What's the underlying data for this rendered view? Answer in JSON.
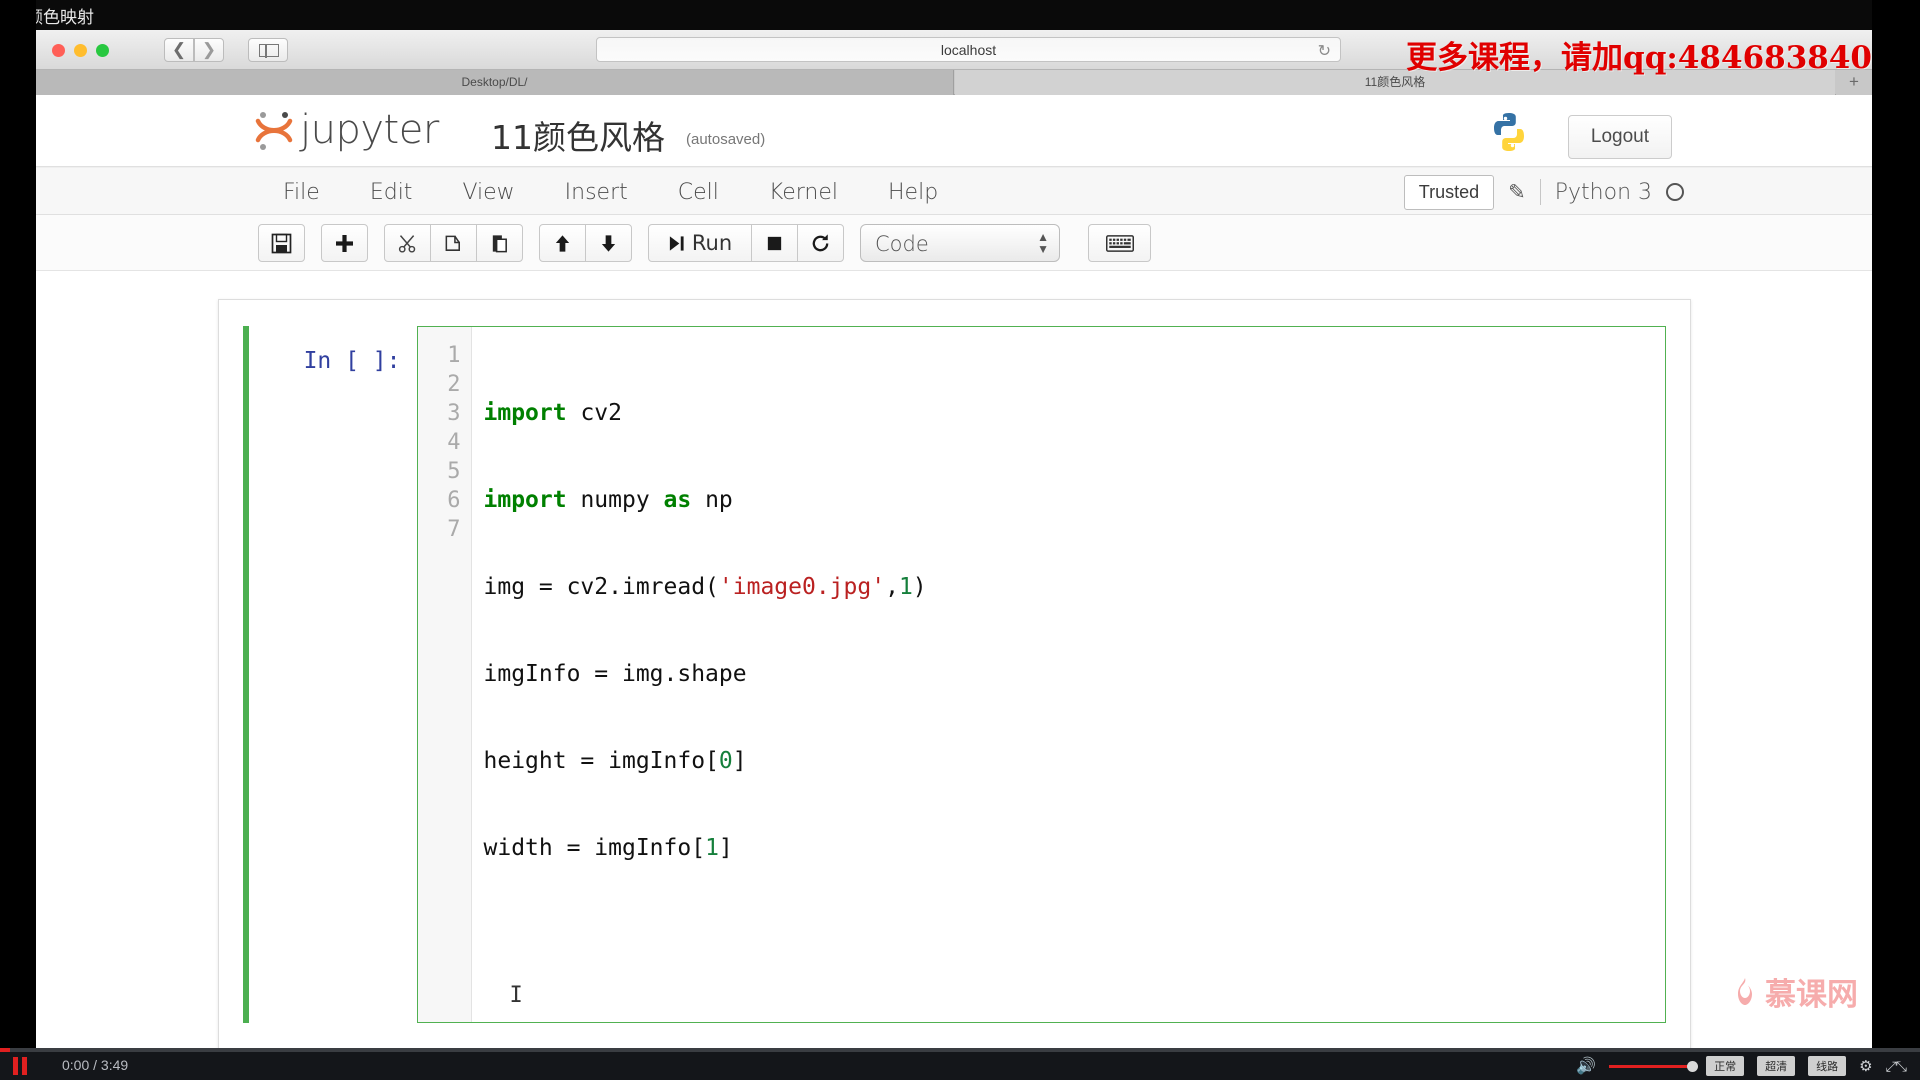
{
  "video": {
    "lesson_title": "颜色映射",
    "current_time": "0:00",
    "total_time": "3:49",
    "pause_icon": "pause-icon",
    "volume_icon": "volume-icon",
    "gear_icon": "gear-icon",
    "fullscreen_icon": "fullscreen-icon",
    "quality_buttons": [
      "正常",
      "超清",
      "线路"
    ],
    "watermark_text": "慕课网",
    "watermark_icon": "flame-icon"
  },
  "promo": {
    "text": "更多课程，请加qq:484683840",
    "color": "#e00000"
  },
  "browser": {
    "traffic_lights": [
      "close-red",
      "minimize-yellow",
      "maximize-green"
    ],
    "back_icon": "chevron-left-icon",
    "forward_icon": "chevron-right-icon",
    "sidebar_icon": "sidebar-toggle-icon",
    "url": "localhost",
    "reload_icon": "reload-icon",
    "new_tab_label": "+",
    "tabs": [
      {
        "label": "Desktop/DL/",
        "active": false
      },
      {
        "label": "11颜色风格",
        "active": true
      }
    ]
  },
  "jupyter": {
    "brand": "jupyter",
    "logo_icon": "jupyter-logo-icon",
    "notebook_title": "11颜色风格",
    "autosave_status": "(autosaved)",
    "python_badge_icon": "python-logo-icon",
    "logout_label": "Logout",
    "menu": [
      "File",
      "Edit",
      "View",
      "Insert",
      "Cell",
      "Kernel",
      "Help"
    ],
    "trusted_label": "Trusted",
    "edit_icon": "pencil-icon",
    "kernel_name": "Python 3",
    "kernel_status_icon": "kernel-idle-circle-icon",
    "toolbar": {
      "groups": [
        [
          {
            "name": "save-button",
            "icon": "floppy-disk-icon",
            "glyph": "💾"
          }
        ],
        [
          {
            "name": "insert-cell-below-button",
            "icon": "plus-icon",
            "glyph": "➕"
          }
        ],
        [
          {
            "name": "cut-cell-button",
            "icon": "scissors-icon",
            "glyph": "✂"
          },
          {
            "name": "copy-cell-button",
            "icon": "copy-icon",
            "glyph": "⧉"
          },
          {
            "name": "paste-cell-button",
            "icon": "paste-icon",
            "glyph": "📋"
          }
        ],
        [
          {
            "name": "move-cell-up-button",
            "icon": "arrow-up-icon",
            "glyph": "⬆"
          },
          {
            "name": "move-cell-down-button",
            "icon": "arrow-down-icon",
            "glyph": "⬇"
          }
        ]
      ],
      "run_label": "Run",
      "run_icon": "run-icon",
      "stop_icon": "stop-square-icon",
      "restart_icon": "restart-circular-arrow-icon",
      "celltype_value": "Code",
      "celltype_arrows_icon": "stepper-arrows-icon",
      "keyboard_icon": "keyboard-icon"
    },
    "cell": {
      "prompt": "In [ ]:",
      "line_numbers": [
        "1",
        "2",
        "3",
        "4",
        "5",
        "6",
        "7"
      ],
      "code_lines": [
        "import cv2",
        "import numpy as np",
        "img = cv2.imread('image0.jpg',1)",
        "imgInfo = img.shape",
        "height = imgInfo[0]",
        "width = imgInfo[1]",
        ""
      ],
      "caret_glyph": "I",
      "accent_color": "#4caf50",
      "string_color": "#BA2121",
      "keyword_color": "#008000"
    }
  }
}
